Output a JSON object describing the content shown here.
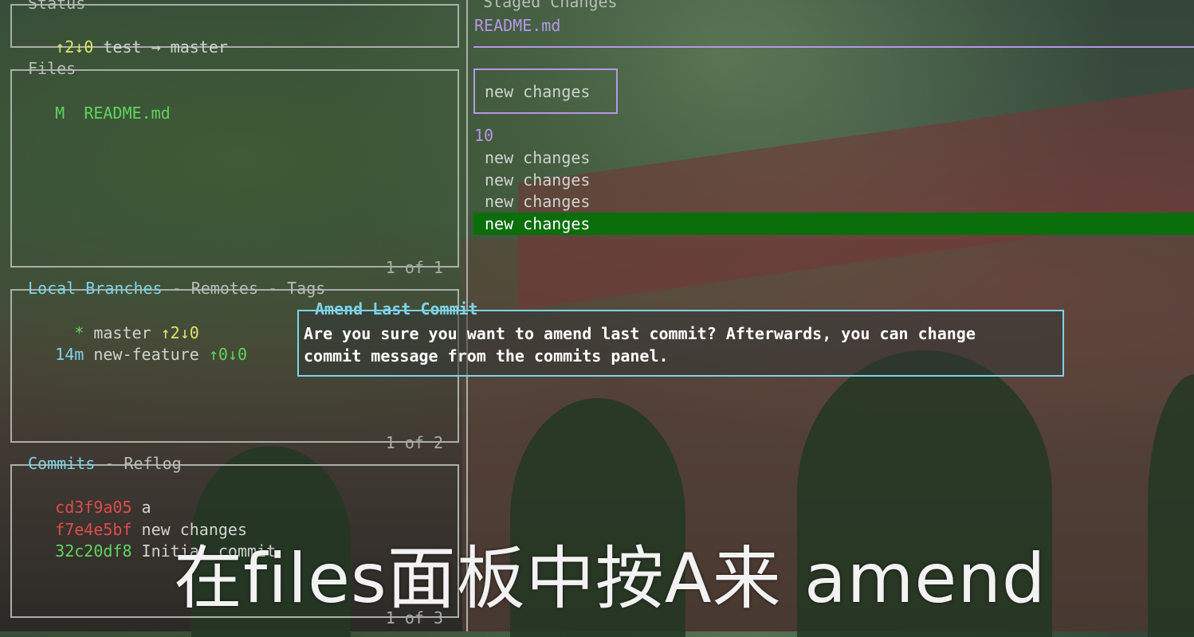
{
  "status": {
    "title": "Status",
    "arrows": "↑2↓0",
    "text": "test → master"
  },
  "files": {
    "title": "Files",
    "items": [
      {
        "status": "M",
        "name": "README.md"
      }
    ],
    "footer": "1 of 1"
  },
  "branches": {
    "tabs": [
      "Local Branches",
      "Remotes",
      "Tags"
    ],
    "separator": " - ",
    "items": [
      {
        "prefix": "  *",
        "name": "master",
        "sync": "↑2↓0"
      },
      {
        "prefix": "14m",
        "name": "new-feature",
        "sync": "↑0↓0"
      }
    ],
    "footer": "1 of 2"
  },
  "commits": {
    "tabs": [
      "Commits",
      "Reflog"
    ],
    "items": [
      {
        "hash": "cd3f9a05",
        "message": "a"
      },
      {
        "hash": "f7e4e5bf",
        "message": "new changes"
      },
      {
        "hash": "32c20df8",
        "message": "Initial commit"
      }
    ],
    "footer": "1 of 3"
  },
  "staged": {
    "title": "Staged Changes",
    "file": "README.md",
    "boxed_line": "new changes",
    "line_number": "10",
    "lines": [
      "new changes",
      "new changes",
      "new changes",
      "new changes"
    ]
  },
  "modal": {
    "title": "Amend Last Commit",
    "message_line1": "Are you sure you want to amend last commit? Afterwards, you can change",
    "message_line2": "commit message from the commits panel."
  },
  "subtitle": "在files面板中按A来 amend",
  "colors": {
    "border": "#a9aea9",
    "accent_cyan": "#7dd3e8",
    "accent_purple": "#b596e6",
    "selection": "#0a6e0a",
    "hash_red": "#e04b4b",
    "hash_green": "#5fd35f"
  }
}
